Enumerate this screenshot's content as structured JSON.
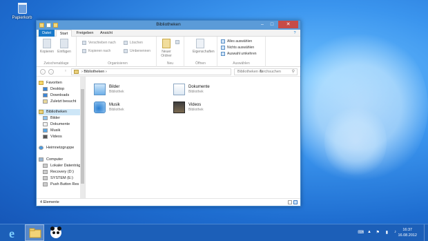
{
  "desktop": {
    "recycle_bin_label": "Papierkorb"
  },
  "window": {
    "title": "Bibliotheken",
    "controls": {
      "minimize": "–",
      "maximize": "□",
      "close": "✕"
    }
  },
  "ribbon_tabs": {
    "file": "Datei",
    "start": "Start",
    "share": "Freigeben",
    "view": "Ansicht",
    "help": "?"
  },
  "ribbon": {
    "clipboard": {
      "copy": "Kopieren",
      "paste": "Einfügen",
      "label": "Zwischenablage"
    },
    "organize": {
      "move_to": "Verschieben nach",
      "copy_to": "Kopieren nach",
      "delete": "Löschen",
      "rename": "Umbenennen",
      "label": "Organisieren"
    },
    "new": {
      "new_folder": "Neuer Ordner",
      "label": "Neu"
    },
    "open": {
      "properties": "Eigenschaften",
      "label": "Öffnen"
    },
    "select": {
      "select_all": "Alles auswählen",
      "select_none": "Nichts auswählen",
      "invert": "Auswahl umkehren",
      "label": "Auswählen"
    }
  },
  "address": {
    "path": "Bibliotheken",
    "sep": "›",
    "search_placeholder": "Bibliotheken durchsuchen",
    "back": "←",
    "forward": "→",
    "up": "↑",
    "refresh": "↻",
    "search_icon": "⚲"
  },
  "nav": {
    "favorites": "Favoriten",
    "desktop": "Desktop",
    "downloads": "Downloads",
    "recent": "Zuletzt besucht",
    "libraries": "Bibliotheken",
    "pictures": "Bilder",
    "documents": "Dokumente",
    "music": "Musik",
    "videos": "Videos",
    "homegroup": "Heimnetzgruppe",
    "computer": "Computer",
    "local_disk": "Lokaler Datenträger",
    "recovery": "Recovery (D:)",
    "system": "SYSTEM (E:)",
    "pushbutton": "Push Button Res"
  },
  "libraries": [
    {
      "name": "Bilder",
      "type": "Bibliothek",
      "icon": "pictures-library-icon"
    },
    {
      "name": "Dokumente",
      "type": "Bibliothek",
      "icon": "documents-library-icon"
    },
    {
      "name": "Musik",
      "type": "Bibliothek",
      "icon": "music-library-icon"
    },
    {
      "name": "Videos",
      "type": "Bibliothek",
      "icon": "videos-library-icon"
    }
  ],
  "status": {
    "count": "4 Elemente"
  },
  "taskbar": {
    "time": "16:37",
    "date": "16.08.2012"
  },
  "colors": {
    "accent": "#1979ca",
    "titlebar": "#5b9bd8",
    "close": "#c74b47",
    "taskbar": "#1c5fb8"
  }
}
